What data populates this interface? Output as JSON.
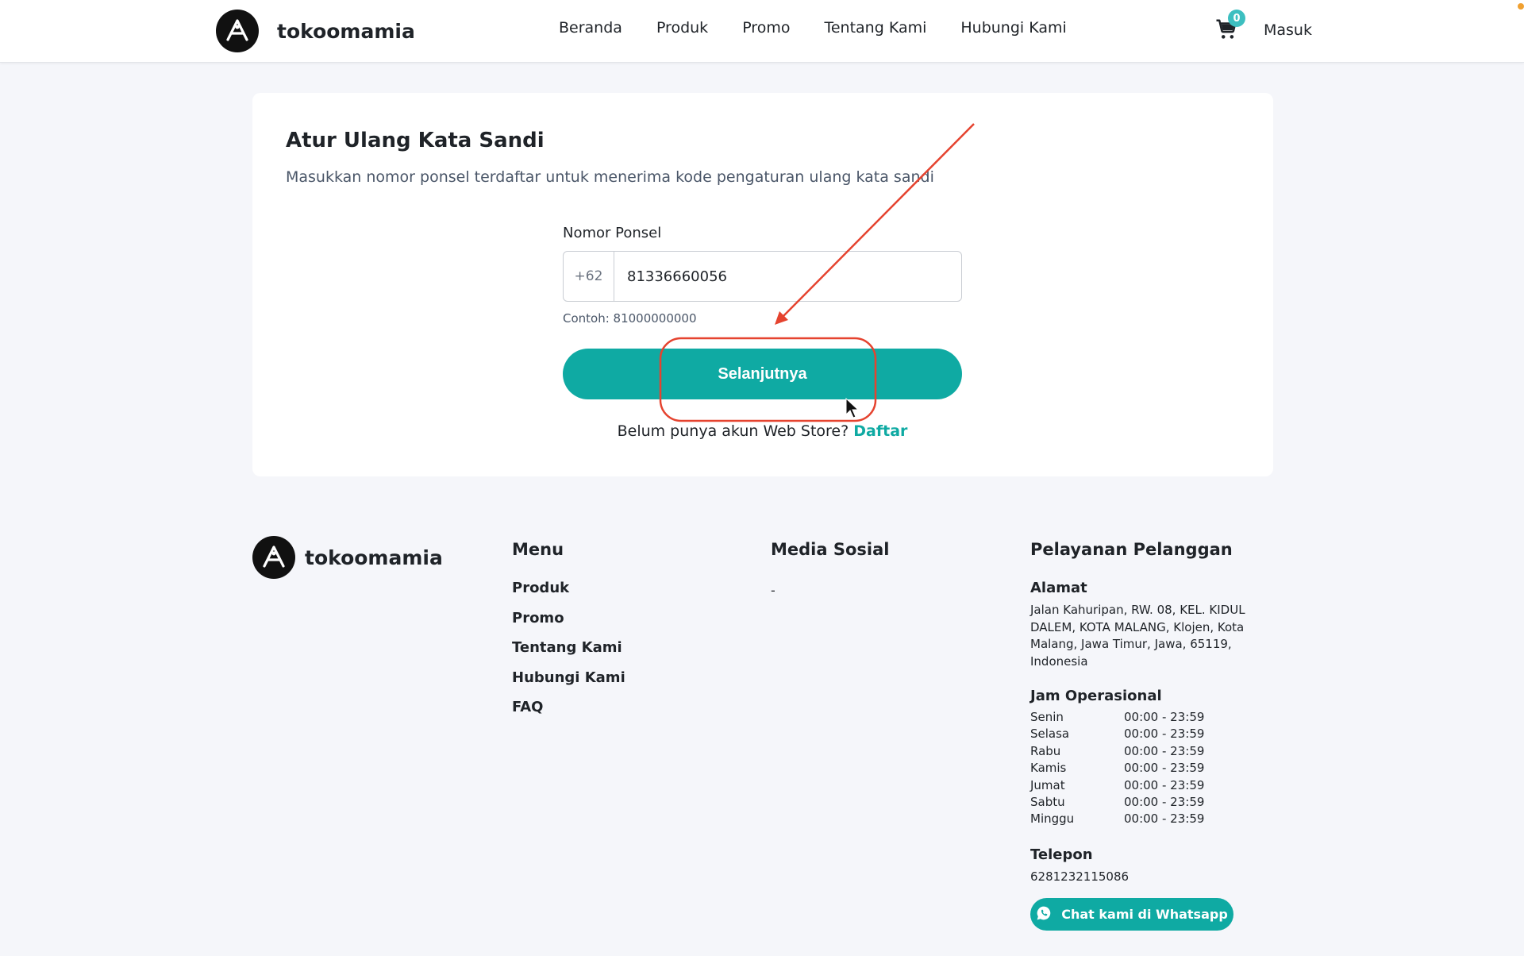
{
  "header": {
    "brand": "tokoomamia",
    "nav": [
      "Beranda",
      "Produk",
      "Promo",
      "Tentang Kami",
      "Hubungi Kami"
    ],
    "cart_count": "0",
    "login": "Masuk"
  },
  "reset": {
    "title": "Atur Ulang Kata Sandi",
    "subtitle": "Masukkan nomor ponsel terdaftar untuk menerima kode pengaturan ulang kata sandi",
    "phone_label": "Nomor Ponsel",
    "phone_prefix": "+62",
    "phone_value": "81336660056",
    "hint": "Contoh: 81000000000",
    "submit": "Selanjutnya",
    "register_text": "Belum punya akun Web Store?",
    "register_link": "Daftar"
  },
  "footer": {
    "brand": "tokoomamia",
    "menu_heading": "Menu",
    "menu": [
      "Produk",
      "Promo",
      "Tentang Kami",
      "Hubungi Kami",
      "FAQ"
    ],
    "social_heading": "Media Sosial",
    "social_value": "-",
    "cs_heading": "Pelayanan Pelanggan",
    "address_label": "Alamat",
    "address_lines": [
      "Jalan Kahuripan, RW. 08, KEL. KIDUL",
      "DALEM, KOTA MALANG, Klojen, Kota",
      "Malang, Jawa Timur, Jawa, 65119,",
      "Indonesia"
    ],
    "hours_label": "Jam Operasional",
    "hours": [
      {
        "day": "Senin",
        "time": "00:00 - 23:59"
      },
      {
        "day": "Selasa",
        "time": "00:00 - 23:59"
      },
      {
        "day": "Rabu",
        "time": "00:00 - 23:59"
      },
      {
        "day": "Kamis",
        "time": "00:00 - 23:59"
      },
      {
        "day": "Jumat",
        "time": "00:00 - 23:59"
      },
      {
        "day": "Sabtu",
        "time": "00:00 - 23:59"
      },
      {
        "day": "Minggu",
        "time": "00:00 - 23:59"
      }
    ],
    "phone_label": "Telepon",
    "phone": "6281232115086",
    "whatsapp": "Chat kami di Whatsapp"
  },
  "colors": {
    "accent": "#0faaa3",
    "badge": "#3dbfc0",
    "annotation": "#e5432f"
  },
  "icons": [
    "logo-icon",
    "cart-icon",
    "whatsapp-icon",
    "cursor-icon"
  ]
}
